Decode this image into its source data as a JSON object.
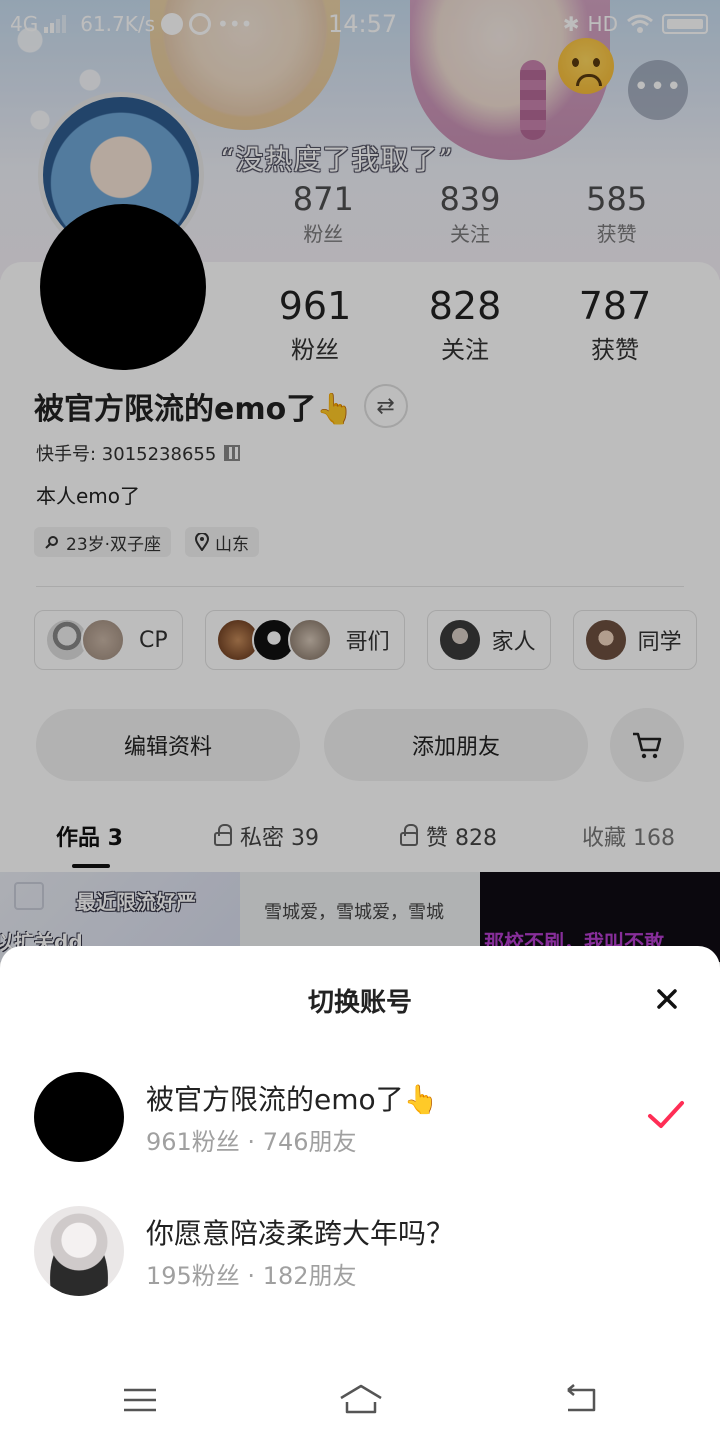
{
  "status_bar": {
    "network": "4G",
    "speed": "61.7K/s",
    "dots": "•••",
    "time": "14:57",
    "hd": "HD",
    "bluetooth": "✱"
  },
  "banner": {
    "caption": "“没热度了我取了”",
    "more_icon": "•••"
  },
  "previous_stats": [
    {
      "num": "871",
      "label": "粉丝"
    },
    {
      "num": "839",
      "label": "关注"
    },
    {
      "num": "585",
      "label": "获赞"
    }
  ],
  "profile": {
    "stats": [
      {
        "num": "961",
        "label": "粉丝"
      },
      {
        "num": "828",
        "label": "关注"
      },
      {
        "num": "787",
        "label": "获赞"
      }
    ],
    "username": "被官方限流的emo了👆",
    "swap_icon": "⇄",
    "kuaishou_id": "快手号: 3015238655",
    "bio": "本人emo了",
    "tags": [
      "23岁·双子座",
      "山东"
    ]
  },
  "groups": [
    {
      "label": "CP"
    },
    {
      "label": "哥们"
    },
    {
      "label": "家人"
    },
    {
      "label": "同学"
    }
  ],
  "actions": {
    "edit": "编辑资料",
    "add_friend": "添加朋友"
  },
  "tabs": [
    {
      "label": "作品 3"
    },
    {
      "label": "私密 39"
    },
    {
      "label": "赞 828"
    },
    {
      "label": "收藏 168"
    }
  ],
  "thumbnails": {
    "t1_line1": "最近限流好严",
    "t1_line2": "以扩关dd",
    "t2": "雪城爱，雪城爱，雪城",
    "t3": "那校不刷，我叫不敢"
  },
  "sheet": {
    "title": "切换账号",
    "accounts": [
      {
        "name": "被官方限流的emo了👆",
        "meta": "961粉丝 · 746朋友",
        "selected": true
      },
      {
        "name": "你愿意陪凌柔跨大年吗？",
        "meta": "195粉丝 · 182朋友",
        "selected": false
      }
    ],
    "accent": "#ff2d55"
  }
}
